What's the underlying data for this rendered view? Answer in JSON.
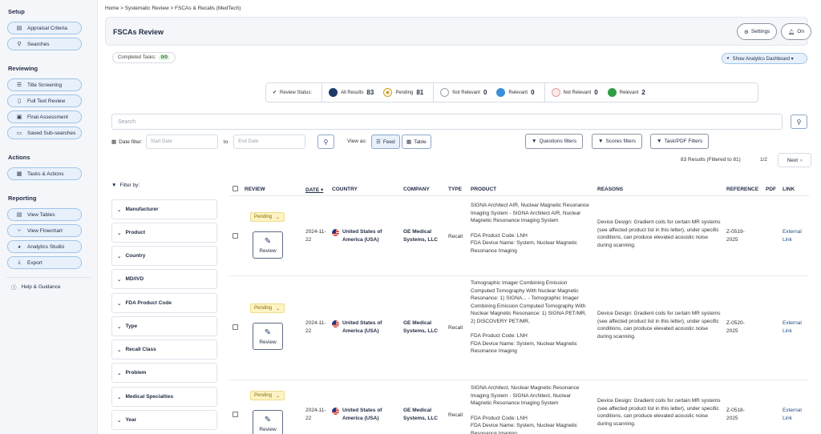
{
  "sidebar": {
    "sections": [
      {
        "title": "Setup",
        "items": [
          {
            "label": "Appraisal Criteria",
            "icon": "list-icon"
          },
          {
            "label": "Searches",
            "icon": "user-icon"
          }
        ]
      },
      {
        "title": "Reviewing",
        "items": [
          {
            "label": "Title Screening",
            "icon": "list-icon"
          },
          {
            "label": "Full Text Review",
            "icon": "document-icon"
          },
          {
            "label": "Final Assessment",
            "icon": "clipboard-icon"
          },
          {
            "label": "Saved Sub-searches",
            "icon": "folder-icon"
          }
        ]
      },
      {
        "title": "Actions",
        "items": [
          {
            "label": "Tasks & Actions",
            "icon": "calendar-icon"
          }
        ]
      },
      {
        "title": "Reporting",
        "items": [
          {
            "label": "View Tables",
            "icon": "table-icon"
          },
          {
            "label": "View Flowchart",
            "icon": "flowchart-icon"
          },
          {
            "label": "Analytics Studio",
            "icon": "pie-chart-icon"
          },
          {
            "label": "Export",
            "icon": "download-icon"
          }
        ]
      }
    ],
    "help_label": "Help & Guidance"
  },
  "breadcrumb": "Home > Systematic Review > FSCAs & Recalls (MedTech)",
  "header": {
    "title": "FSCAs Review",
    "settings_label": "Settings",
    "toggle_label": "On"
  },
  "completed": {
    "label": "Completed Tasks:",
    "count": "0/0"
  },
  "analytics_label": "Show Analytics Dashboard ▾",
  "status": {
    "label": "Review Status:",
    "items": [
      {
        "label": "All Results",
        "count": "83",
        "color": "#1f3a68",
        "ring": "#1f3a68"
      },
      {
        "label": "Pending",
        "count": "81",
        "color": "#fdf3c4",
        "ring": "#c9a227"
      },
      {
        "label": "Not Relevant",
        "count": "0",
        "color": "#ffffff",
        "ring": "#9aa3b2"
      },
      {
        "label": "Relevant",
        "count": "0",
        "color": "#3b8fd9",
        "ring": "#3b8fd9"
      },
      {
        "label": "Not Relevant",
        "count": "0",
        "color": "#fde8e8",
        "ring": "#e0a0a0"
      },
      {
        "label": "Relevant",
        "count": "2",
        "color": "#2e9e44",
        "ring": "#2e9e44"
      }
    ]
  },
  "search": {
    "placeholder": "Search"
  },
  "date_filter": {
    "label": "Date filter:",
    "start": "Start Date",
    "to": "to",
    "end": "End Date"
  },
  "view_as": {
    "label": "View as:",
    "feed": "Feed",
    "table": "Table"
  },
  "filters": {
    "questions": "Questions filters",
    "scores": "Scores filters",
    "task_pdf": "Task/PDF Filters"
  },
  "results": {
    "info": "83 Results (Filtered to 81)",
    "page": "1/2",
    "next": "Next"
  },
  "facets": {
    "title": "Filter by:",
    "items": [
      "Manufacturer",
      "Product",
      "Country",
      "MD/IVD",
      "FDA Product Code",
      "Type",
      "Recall Class",
      "Problem",
      "Medical Specialties",
      "Year"
    ]
  },
  "table": {
    "columns": [
      "REVIEW",
      "DATE ▾",
      "COUNTRY",
      "COMPANY",
      "TYPE",
      "PRODUCT",
      "REASONS",
      "REFERENCE",
      "PDF",
      "LINK"
    ],
    "pending_label": "Pending",
    "review_label": "Review",
    "rows": [
      {
        "date": "2024-11-22",
        "country": "United States of America (USA)",
        "company": "GE Medical Systems, LLC",
        "type": "Recall",
        "product": "SIGNA Architect AIR, Nuclear Magnetic Resonance Imaging System - SIGNA Architect AIR, Nuclear Magnetic Resonance Imaging System",
        "product_code": "FDA Product Code: LNH",
        "device_name": "FDA Device Name: System, Nuclear Magnetic Resonance Imaging",
        "reasons": "Device Design: Gradient coils for certain MR systems (see affected product list in this letter), under specific conditions, can produce elevated acoustic noise during scanning.",
        "reference": "Z-0519-2025",
        "link": "External Link"
      },
      {
        "date": "2024-11-22",
        "country": "United States of America (USA)",
        "company": "GE Medical Systems, LLC",
        "type": "Recall",
        "product": "Tomographic Imager Combining Emission Computed Tomography With Nuclear Magnetic Resonance: 1) SIGNA... - Tomographic Imager Combining Emission Computed Tomography With Nuclear Magnetic Resonance: 1) SIGNA PET/MR, 2) DISCOVERY PET/MR,",
        "product_code": "FDA Product Code: LNH",
        "device_name": "FDA Device Name: System, Nuclear Magnetic Resonance Imaging",
        "reasons": "Device Design: Gradient coils for certain MR systems (see affected product list in this letter), under specific conditions, can produce elevated acoustic noise during scanning.",
        "reference": "Z-0520-2025",
        "link": "External Link"
      },
      {
        "date": "2024-11-22",
        "country": "United States of America (USA)",
        "company": "GE Medical Systems, LLC",
        "type": "Recall",
        "product": "SIGNA Architect, Nuclear Magnetic Resonance Imaging System - SIGNA Architect, Nuclear Magnetic Resonance Imaging System",
        "product_code": "FDA Product Code: LNH",
        "device_name": "FDA Device Name: System, Nuclear Magnetic Resonance Imaging",
        "reasons": "Device Design: Gradient coils for certain MR systems (see affected product list in this letter), under specific conditions, can produce elevated acoustic noise during scanning.",
        "reference": "Z-0518-2025",
        "link": "External Link"
      }
    ]
  }
}
